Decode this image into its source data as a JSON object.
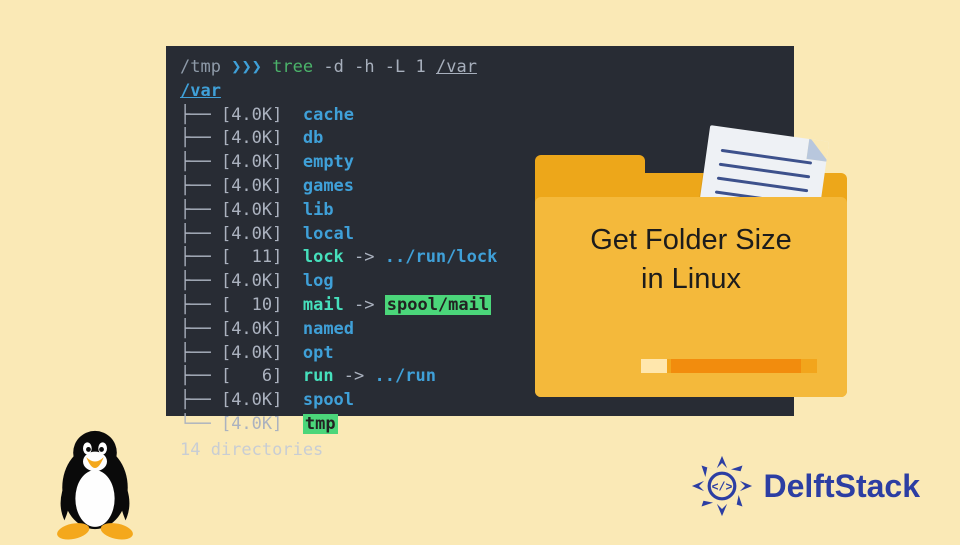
{
  "terminal": {
    "prompt_path": "/tmp",
    "prompt_arrows": "❯❯❯",
    "command": "tree",
    "options": "-d -h -L 1",
    "argument": "/var",
    "root_dir": "/var",
    "entries": [
      {
        "branch": "├──",
        "size": "4.0K",
        "name": "cache",
        "link": "",
        "hl": false
      },
      {
        "branch": "├──",
        "size": "4.0K",
        "name": "db",
        "link": "",
        "hl": false
      },
      {
        "branch": "├──",
        "size": "4.0K",
        "name": "empty",
        "link": "",
        "hl": false
      },
      {
        "branch": "├──",
        "size": "4.0K",
        "name": "games",
        "link": "",
        "hl": false
      },
      {
        "branch": "├──",
        "size": "4.0K",
        "name": "lib",
        "link": "",
        "hl": false
      },
      {
        "branch": "├──",
        "size": "4.0K",
        "name": "local",
        "link": "",
        "hl": false
      },
      {
        "branch": "├──",
        "size": "  11",
        "name": "lock",
        "link": "../run/lock",
        "hl": false
      },
      {
        "branch": "├──",
        "size": "4.0K",
        "name": "log",
        "link": "",
        "hl": false
      },
      {
        "branch": "├──",
        "size": "  10",
        "name": "mail",
        "link": "spool/mail",
        "hl": true
      },
      {
        "branch": "├──",
        "size": "4.0K",
        "name": "named",
        "link": "",
        "hl": false
      },
      {
        "branch": "├──",
        "size": "4.0K",
        "name": "opt",
        "link": "",
        "hl": false
      },
      {
        "branch": "├──",
        "size": "   6",
        "name": "run",
        "link": "../run",
        "hl": false
      },
      {
        "branch": "├──",
        "size": "4.0K",
        "name": "spool",
        "link": "",
        "hl": false
      },
      {
        "branch": "└──",
        "size": "4.0K",
        "name": "tmp",
        "link": "",
        "hl": true
      }
    ],
    "summary": "14 directories"
  },
  "card": {
    "title_line1": "Get Folder Size",
    "title_line2": "in Linux"
  },
  "brand": {
    "text": "DelftStack"
  }
}
